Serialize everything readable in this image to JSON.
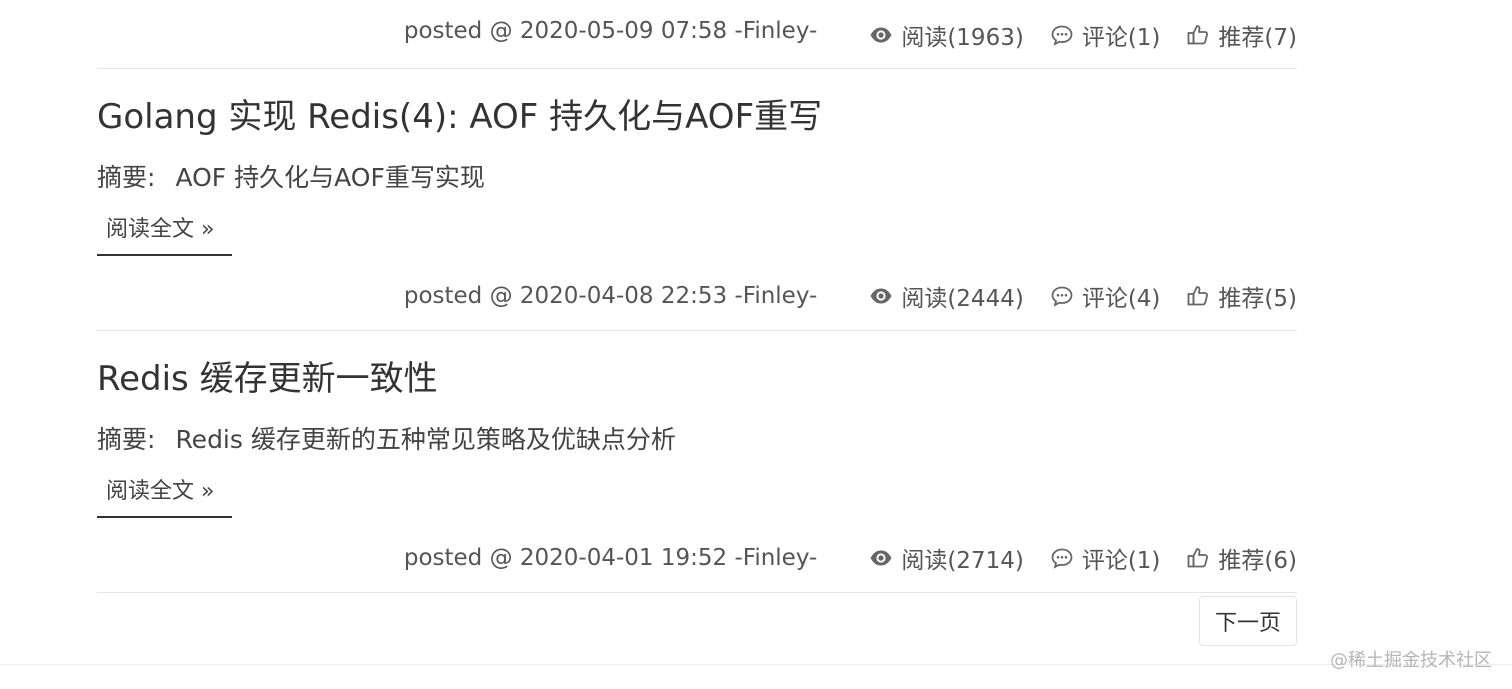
{
  "posts": [
    {
      "title": "",
      "summary_label": "",
      "summary": "",
      "read_more": "",
      "meta": {
        "posted": "posted @ 2020-05-09 07:58 -Finley-",
        "views": "阅读(1963)",
        "comments": "评论(1)",
        "recommend": "推荐(7)"
      }
    },
    {
      "title": "Golang 实现 Redis(4): AOF 持久化与AOF重写",
      "summary_label": "摘要:",
      "summary": "AOF 持久化与AOF重写实现",
      "read_more": "阅读全文 »",
      "meta": {
        "posted": "posted @ 2020-04-08 22:53 -Finley-",
        "views": "阅读(2444)",
        "comments": "评论(4)",
        "recommend": "推荐(5)"
      }
    },
    {
      "title": "Redis 缓存更新一致性",
      "summary_label": "摘要:",
      "summary": "Redis 缓存更新的五种常见策略及优缺点分析",
      "read_more": "阅读全文 »",
      "meta": {
        "posted": "posted @ 2020-04-01 19:52 -Finley-",
        "views": "阅读(2714)",
        "comments": "评论(1)",
        "recommend": "推荐(6)"
      }
    }
  ],
  "pager": {
    "next_label": "下一页"
  },
  "watermark": "@稀土掘金技术社区",
  "icons": {
    "views": "eye-icon",
    "comments": "comment-icon",
    "recommend": "thumbs-up-icon"
  },
  "colors": {
    "text": "#333333",
    "meta": "#555555",
    "divider": "#e6e6e6",
    "watermark": "#b5b5b5"
  }
}
